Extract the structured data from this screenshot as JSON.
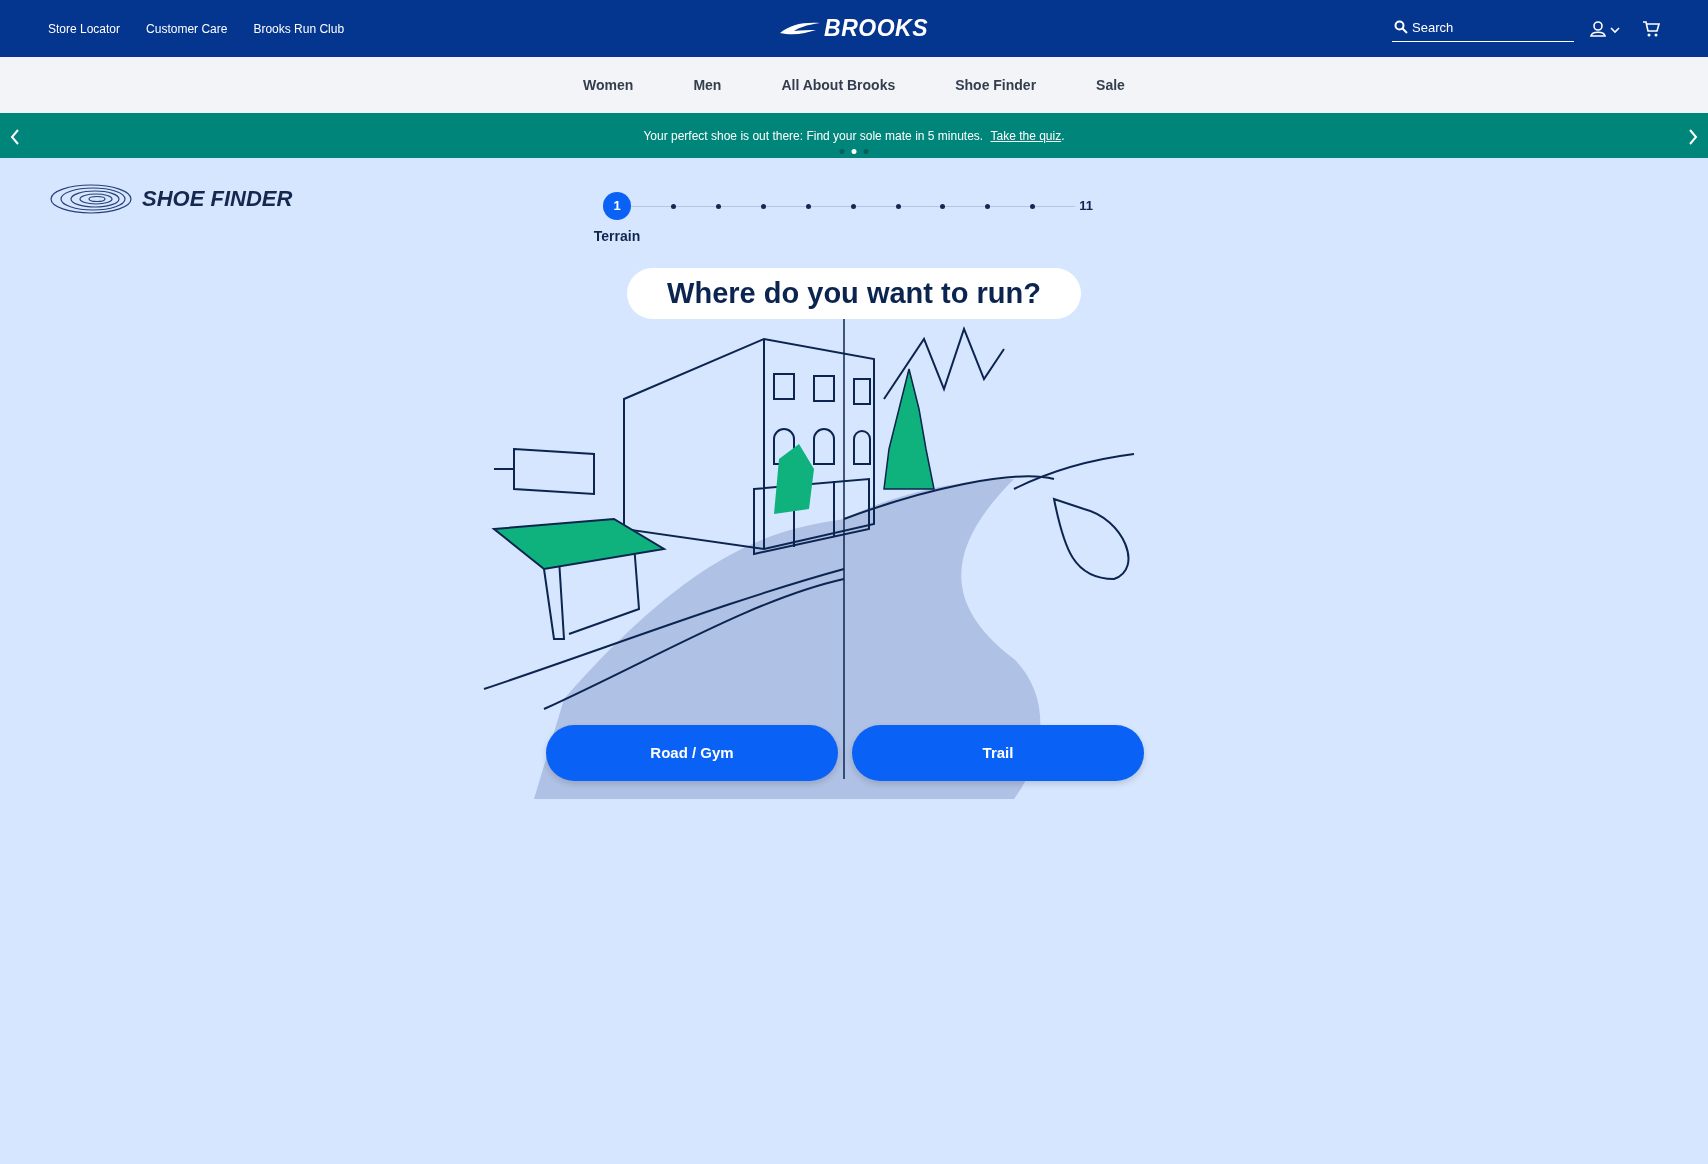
{
  "utility_links": [
    "Store Locator",
    "Customer Care",
    "Brooks Run Club"
  ],
  "logo": "BROOKS",
  "search": {
    "placeholder": "Search"
  },
  "main_nav": [
    "Women",
    "Men",
    "All About Brooks",
    "Shoe Finder",
    "Sale"
  ],
  "banner": {
    "message": "Your perfect shoe is out there: Find your sole mate in 5 minutes.",
    "link": "Take the quiz",
    "suffix": ".",
    "dots": [
      {
        "selected": false
      },
      {
        "selected": true
      },
      {
        "selected": false
      }
    ]
  },
  "shoe_finder": {
    "title": "SHOE FINDER"
  },
  "stepper": [
    {
      "number": "1",
      "label": "Terrain",
      "selected": true
    },
    {
      "selected": false
    },
    {
      "selected": false
    },
    {
      "selected": false
    },
    {
      "selected": false
    },
    {
      "selected": false
    },
    {
      "selected": false
    },
    {
      "selected": false
    },
    {
      "selected": false
    },
    {
      "selected": false
    },
    {
      "number": "11",
      "selected": false
    }
  ],
  "question": "Where do you want to run?",
  "options": [
    "Road / Gym",
    "Trail"
  ]
}
